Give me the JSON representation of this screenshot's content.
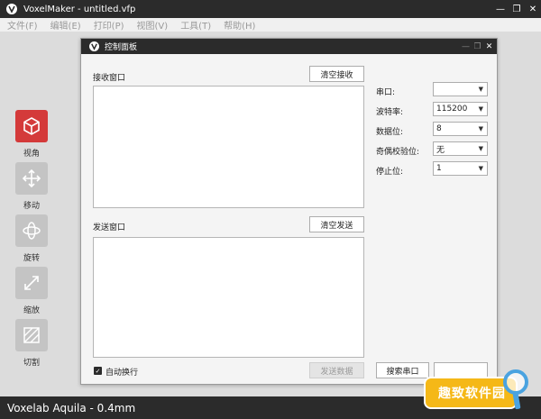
{
  "window": {
    "title": "VoxelMaker - untitled.vfp"
  },
  "menu": [
    "文件(F)",
    "编辑(E)",
    "打印(P)",
    "视图(V)",
    "工具(T)",
    "帮助(H)"
  ],
  "toolbar": [
    {
      "label": "视角",
      "icon": "cube-icon",
      "active": true
    },
    {
      "label": "移动",
      "icon": "move-arrows-icon",
      "active": false
    },
    {
      "label": "旋转",
      "icon": "rotate-icon",
      "active": false
    },
    {
      "label": "缩放",
      "icon": "scale-icon",
      "active": false
    },
    {
      "label": "切割",
      "icon": "cut-icon",
      "active": false
    }
  ],
  "dialog": {
    "title": "控制面板",
    "receive_label": "接收窗口",
    "clear_receive": "清空接收",
    "send_label": "发送窗口",
    "clear_send": "清空发送",
    "auto_wrap": "自动换行",
    "auto_wrap_checked": true,
    "send_data": "发送数据",
    "search_port": "搜索串口",
    "settings": {
      "port_label": "串口:",
      "port_value": "",
      "baud_label": "波特率:",
      "baud_value": "115200",
      "databits_label": "数据位:",
      "databits_value": "8",
      "parity_label": "奇偶校验位:",
      "parity_value": "无",
      "stopbits_label": "停止位:",
      "stopbits_value": "1"
    }
  },
  "status": {
    "printer": "Voxelab Aquila - 0.4mm"
  },
  "watermark": {
    "text": "趣致软件园"
  },
  "colors": {
    "accent": "#d43a3a",
    "titlebar": "#2b2b2b"
  }
}
